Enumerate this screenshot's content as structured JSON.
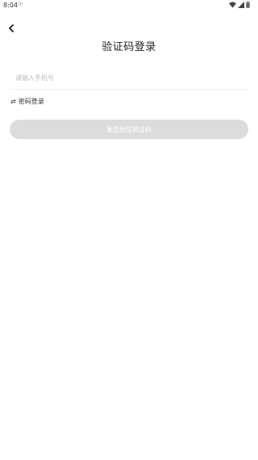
{
  "status_bar": {
    "time": "8:04",
    "notification_icon": "notification-dot-icon",
    "icons": [
      "wifi-icon",
      "signal-icon",
      "battery-icon"
    ]
  },
  "header": {
    "back_icon": "chevron-left-icon",
    "title": "验证码登录"
  },
  "form": {
    "phone_placeholder": "请输入手机号",
    "phone_value": ""
  },
  "switch_login": {
    "icon": "swap-icon",
    "label": "密码登录"
  },
  "send_button": {
    "label": "发送短信验证码",
    "enabled": false
  },
  "colors": {
    "button_disabled_bg": "#dcdcdc",
    "placeholder": "#bbbbbb",
    "text": "#222222"
  }
}
